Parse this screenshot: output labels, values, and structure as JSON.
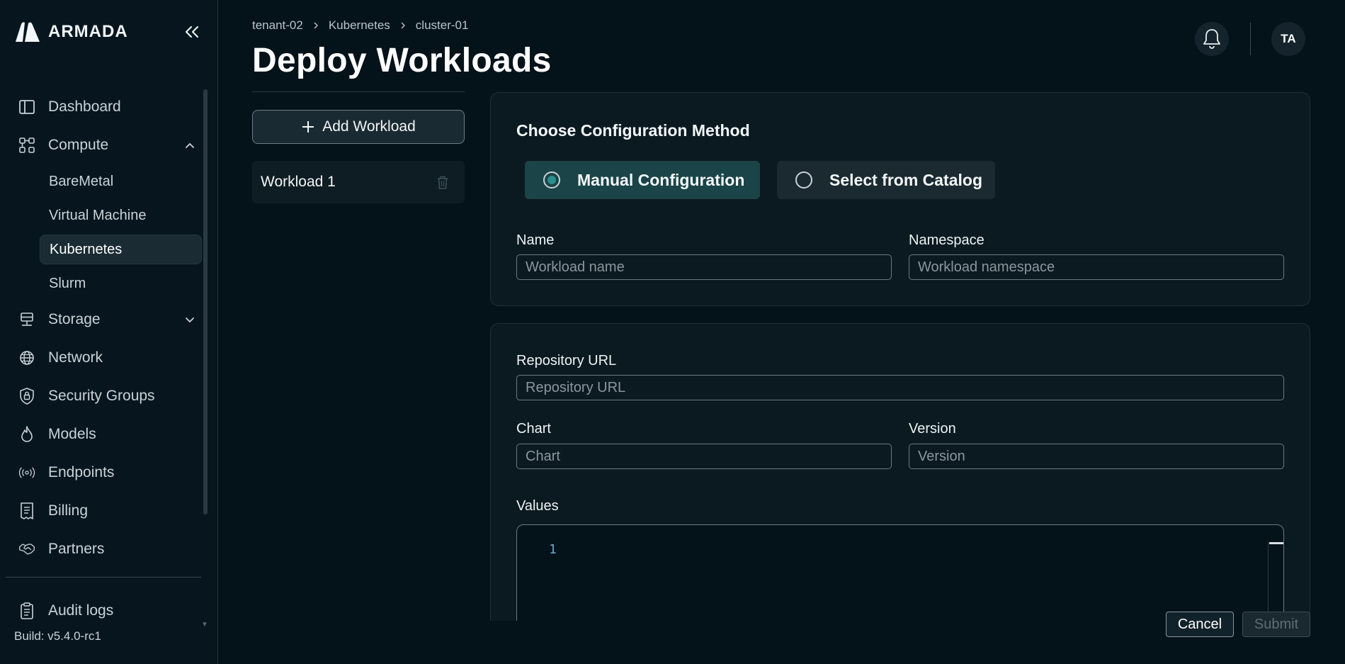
{
  "brand": {
    "name": "ARMADA",
    "icon": "armada-logo"
  },
  "sidebar": {
    "items": [
      {
        "label": "Dashboard",
        "icon": "dashboard-icon"
      },
      {
        "label": "Compute",
        "icon": "compute-icon",
        "expanded": true,
        "children": [
          {
            "label": "BareMetal"
          },
          {
            "label": "Virtual Machine"
          },
          {
            "label": "Kubernetes",
            "active": true
          },
          {
            "label": "Slurm"
          }
        ]
      },
      {
        "label": "Storage",
        "icon": "storage-icon",
        "expanded": false
      },
      {
        "label": "Network",
        "icon": "globe-icon"
      },
      {
        "label": "Security Groups",
        "icon": "shield-lock-icon"
      },
      {
        "label": "Models",
        "icon": "flame-icon"
      },
      {
        "label": "Endpoints",
        "icon": "broadcast-icon"
      },
      {
        "label": "Billing",
        "icon": "receipt-icon"
      },
      {
        "label": "Partners",
        "icon": "handshake-icon"
      }
    ],
    "audit_logs": "Audit logs",
    "build": "Build: v5.4.0-rc1"
  },
  "breadcrumb": [
    "tenant-02",
    "Kubernetes",
    "cluster-01"
  ],
  "page_title": "Deploy Workloads",
  "header": {
    "avatar_initials": "TA"
  },
  "workloads": {
    "add_label": "Add Workload",
    "items": [
      {
        "label": "Workload 1"
      }
    ]
  },
  "config": {
    "title": "Choose Configuration Method",
    "options": [
      "Manual Configuration",
      "Select from Catalog"
    ],
    "selected": "Manual Configuration",
    "name_label": "Name",
    "name_placeholder": "Workload name",
    "namespace_label": "Namespace",
    "namespace_placeholder": "Workload namespace"
  },
  "chart_form": {
    "repo_label": "Repository URL",
    "repo_placeholder": "Repository URL",
    "chart_label": "Chart",
    "chart_placeholder": "Chart",
    "version_label": "Version",
    "version_placeholder": "Version",
    "values_label": "Values",
    "editor_line": "1"
  },
  "actions": {
    "cancel": "Cancel",
    "submit": "Submit"
  },
  "colors": {
    "background": "#04121a",
    "selected_option": "#1a4448",
    "accent": "#2a8d8d"
  }
}
